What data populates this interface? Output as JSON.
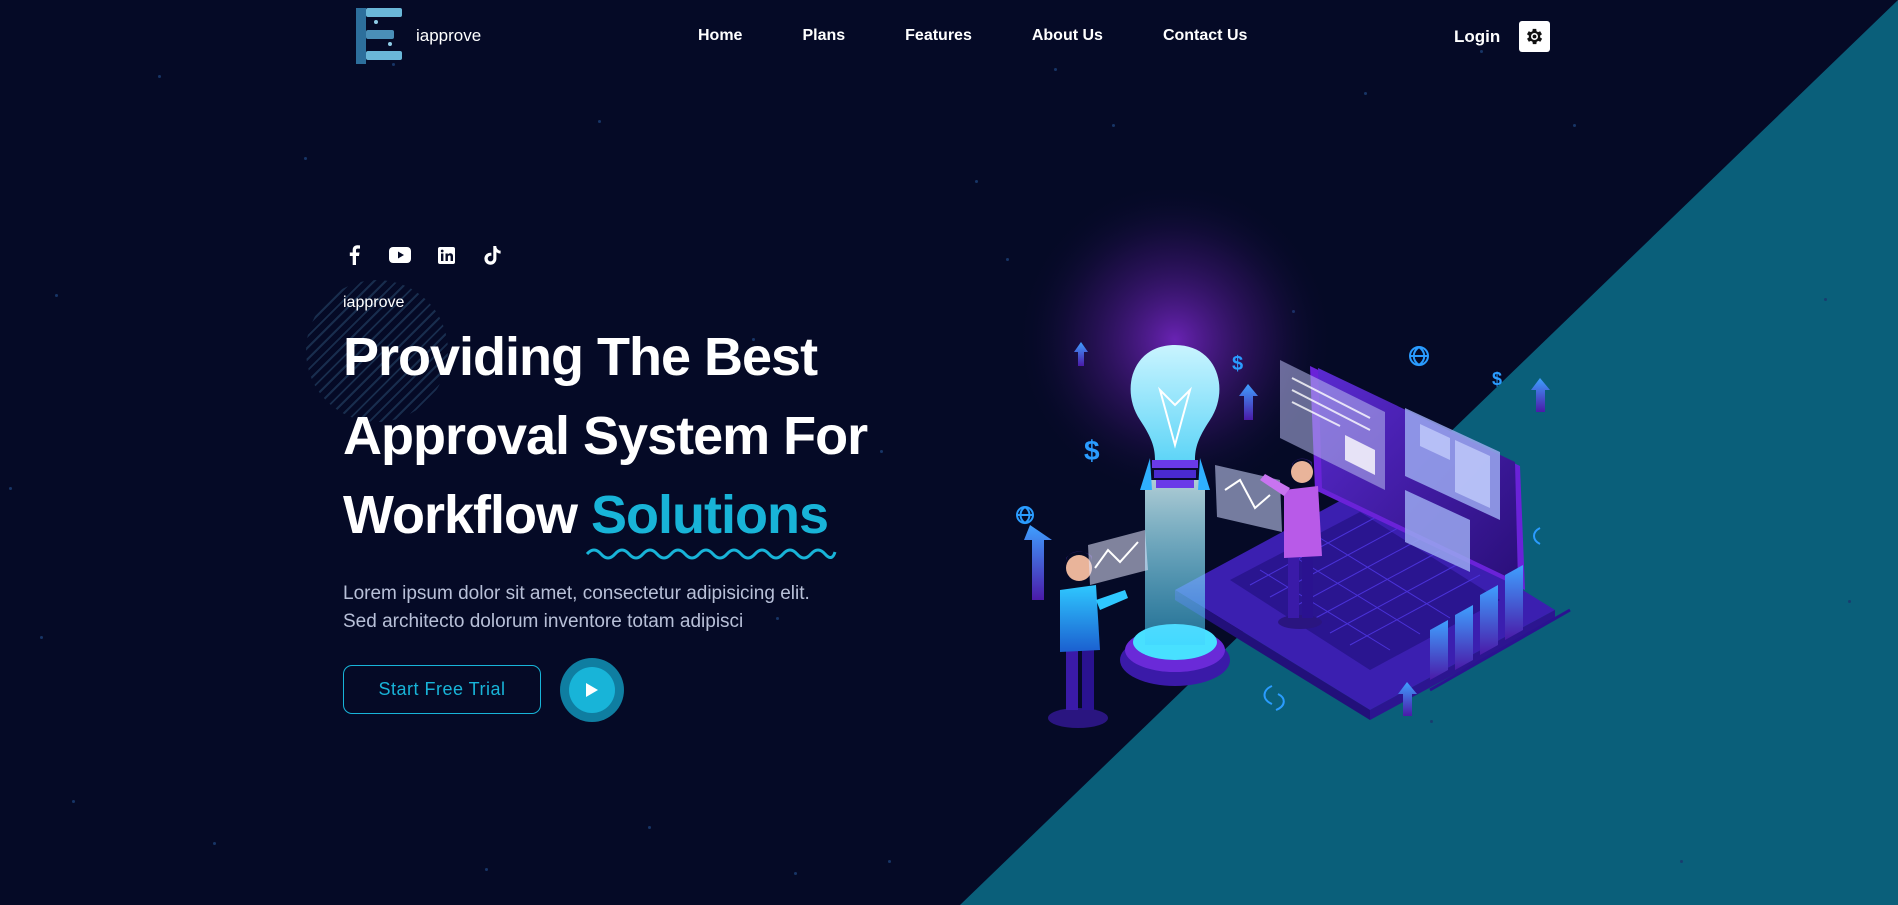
{
  "brand": {
    "name": "iapprove",
    "logo_icon": "logo-e-mark-icon"
  },
  "nav": {
    "items": [
      "Home",
      "Plans",
      "Features",
      "About Us",
      "Contact Us"
    ],
    "login_label": "Login",
    "settings_icon": "gear-icon"
  },
  "hero": {
    "social_icons": [
      "facebook-icon",
      "youtube-icon",
      "linkedin-icon",
      "tiktok-icon"
    ],
    "eyebrow": "iapprove",
    "headline_line1": "Providing The Best",
    "headline_line2": "Approval System For",
    "headline_line3": "Workflow",
    "headline_accent": "Solutions",
    "description_line1": "Lorem ipsum dolor sit amet, consectetur adipisicing elit.",
    "description_line2": "Sed architecto dolorum inventore totam adipisci",
    "cta_label": "Start Free Trial",
    "play_icon": "play-icon"
  },
  "colors": {
    "background": "#050a26",
    "accent": "#18b4d8",
    "teal_panel": "#0a5f7a",
    "text": "#ffffff",
    "muted_text": "#b8c0d8"
  }
}
